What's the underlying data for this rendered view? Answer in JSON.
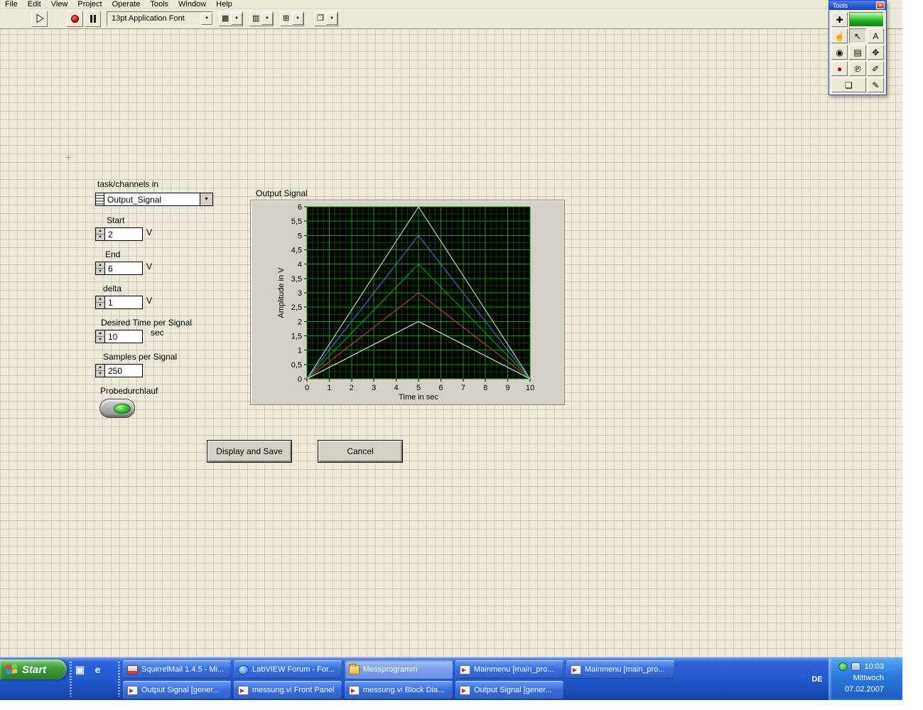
{
  "menubar": {
    "items": [
      "File",
      "Edit",
      "View",
      "Project",
      "Operate",
      "Tools",
      "Window",
      "Help"
    ]
  },
  "toolbar": {
    "font_selector": "13pt Application Font",
    "align_icon": "▦",
    "distribute_icon": "▥",
    "resize_icon": "⊞",
    "reorder_icon": "❐"
  },
  "icons": {
    "dropdown_arrow": "▼",
    "increment": "▲",
    "decrement": "▼",
    "origin_marker": "+"
  },
  "tools_palette": {
    "title": "Tools",
    "close_icon": "✕",
    "tools": [
      {
        "name": "automatic-tool-select",
        "glyph": "✚"
      },
      {
        "name": "auto-tool-indicator",
        "glyph": ""
      },
      {
        "name": "operate-value-tool",
        "glyph": "☝"
      },
      {
        "name": "position-select-tool",
        "glyph": "↖"
      },
      {
        "name": "edit-text-tool",
        "glyph": "A"
      },
      {
        "name": "connect-wire-tool",
        "glyph": "◉"
      },
      {
        "name": "object-shortcut-menu-tool",
        "glyph": "▤"
      },
      {
        "name": "scroll-window-tool",
        "glyph": "✥"
      },
      {
        "name": "set-breakpoint-tool",
        "glyph": "●"
      },
      {
        "name": "probe-data-tool",
        "glyph": "℗"
      },
      {
        "name": "get-color-tool",
        "glyph": "✐"
      },
      {
        "name": "set-color-tool",
        "glyph": "❏"
      },
      {
        "name": "paint-tool",
        "glyph": "✎"
      }
    ]
  },
  "panel": {
    "task_channels": {
      "label": "task/channels in",
      "value": "Output_Signal"
    },
    "start": {
      "label": "Start",
      "value": "2",
      "unit": "V"
    },
    "end": {
      "label": "End",
      "value": "6",
      "unit": "V"
    },
    "delta": {
      "label": "delta",
      "value": "1",
      "unit": "V"
    },
    "desired_time": {
      "label": "Desired Time per Signal",
      "value": "10",
      "unit": "sec"
    },
    "samples": {
      "label": "Samples per Signal",
      "value": "250"
    },
    "probe": {
      "label": "Probedurchlauf"
    },
    "display_save_button": "Display and Save",
    "cancel_button": "Cancel"
  },
  "chart_data": {
    "type": "line",
    "title": "Output Signal",
    "xlabel": "Time in sec",
    "ylabel": "Amplitude in V",
    "xlim": [
      0,
      10
    ],
    "ylim": [
      0,
      6
    ],
    "x_tick_step": 1,
    "y_tick_step": 0.5,
    "x_tick_labels": [
      "0",
      "1",
      "2",
      "3",
      "4",
      "5",
      "6",
      "7",
      "8",
      "9",
      "10"
    ],
    "y_tick_labels": [
      "0",
      "0,5",
      "1",
      "1,5",
      "2",
      "2,5",
      "3",
      "3,5",
      "4",
      "4,5",
      "5",
      "5,5",
      "6"
    ],
    "plot_bg": "#000000",
    "grid_major_color": "#00a000",
    "grid_minor_color": "#004000",
    "grid": true,
    "legend_position": "none",
    "series": [
      {
        "name": "triangle-peak-6V",
        "color": "#e8e8e8",
        "x": [
          0,
          5,
          10
        ],
        "y": [
          0,
          6,
          0
        ]
      },
      {
        "name": "triangle-peak-5V",
        "color": "#5577e8",
        "x": [
          0,
          5,
          10
        ],
        "y": [
          0,
          5,
          0
        ]
      },
      {
        "name": "triangle-peak-4V",
        "color": "#00b000",
        "x": [
          0,
          5,
          10
        ],
        "y": [
          0,
          4,
          0
        ]
      },
      {
        "name": "triangle-peak-3V",
        "color": "#e04040",
        "x": [
          0,
          5,
          10
        ],
        "y": [
          0,
          3,
          0
        ]
      },
      {
        "name": "triangle-peak-2V",
        "color": "#ffffff",
        "x": [
          0,
          5,
          10
        ],
        "y": [
          0,
          2,
          0
        ]
      }
    ]
  },
  "taskbar": {
    "start_label": "Start",
    "quick_launch": [
      {
        "name": "quick-launch-app-icon",
        "glyph": "▣"
      },
      {
        "name": "internet-explorer-icon",
        "glyph": "e"
      }
    ],
    "row1": [
      {
        "icon": "mail",
        "label": "SquirrelMail 1.4.5 - Mi...",
        "active": false
      },
      {
        "icon": "web",
        "label": "LabVIEW Forum - For...",
        "active": false
      },
      {
        "icon": "folder",
        "label": "Messprogramm",
        "active": true
      },
      {
        "icon": "vi",
        "label": "Mainmenu [main_pro...",
        "active": false
      },
      {
        "icon": "vi",
        "label": "Mainmenu [main_pro...",
        "active": false
      }
    ],
    "row2": [
      {
        "icon": "vi",
        "label": "Output Signal [gener...",
        "active": false
      },
      {
        "icon": "vi",
        "label": "messung.vi Front Panel",
        "active": false
      },
      {
        "icon": "vi",
        "label": "messung.vi Block Dia...",
        "active": false
      },
      {
        "icon": "vi",
        "label": "Output Signal [gener...",
        "active": false
      }
    ],
    "tray": {
      "language": "DE",
      "time": "10:03",
      "day": "Mittwoch",
      "date": "07.02.2007"
    }
  }
}
